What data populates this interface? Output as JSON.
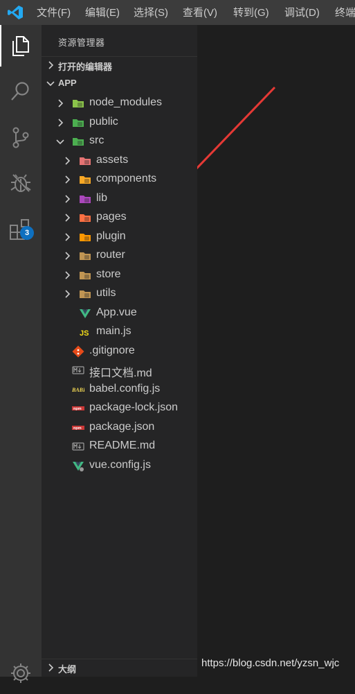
{
  "menu": [
    {
      "id": "file",
      "label": "文件(F)"
    },
    {
      "id": "edit",
      "label": "编辑(E)"
    },
    {
      "id": "selection",
      "label": "选择(S)"
    },
    {
      "id": "view",
      "label": "查看(V)"
    },
    {
      "id": "goto",
      "label": "转到(G)"
    },
    {
      "id": "debug",
      "label": "调试(D)"
    },
    {
      "id": "terminal",
      "label": "终端"
    }
  ],
  "activity": {
    "extensions_badge": "3"
  },
  "sidebar": {
    "title": "资源管理器",
    "open_editors": "打开的编辑器",
    "app": "APP",
    "outline": "大纲"
  },
  "tree": [
    {
      "label": "node_modules",
      "kind": "folder",
      "depth": 0,
      "expanded": false,
      "icon": "node-folder-icon",
      "color": "#8bc34a"
    },
    {
      "label": "public",
      "kind": "folder",
      "depth": 0,
      "expanded": false,
      "icon": "public-folder-icon",
      "color": "#4caf50"
    },
    {
      "label": "src",
      "kind": "folder",
      "depth": 0,
      "expanded": true,
      "icon": "src-folder-icon",
      "color": "#4caf50"
    },
    {
      "label": "assets",
      "kind": "folder",
      "depth": 1,
      "expanded": false,
      "icon": "assets-folder-icon",
      "color": "#e57373"
    },
    {
      "label": "components",
      "kind": "folder",
      "depth": 1,
      "expanded": false,
      "icon": "components-folder-icon",
      "color": "#f9a825"
    },
    {
      "label": "lib",
      "kind": "folder",
      "depth": 1,
      "expanded": false,
      "icon": "lib-folder-icon",
      "color": "#ab47bc"
    },
    {
      "label": "pages",
      "kind": "folder",
      "depth": 1,
      "expanded": false,
      "icon": "pages-folder-icon",
      "color": "#ff7043"
    },
    {
      "label": "plugin",
      "kind": "folder",
      "depth": 1,
      "expanded": false,
      "icon": "plugin-folder-icon",
      "color": "#ff9800"
    },
    {
      "label": "router",
      "kind": "folder",
      "depth": 1,
      "expanded": false,
      "icon": "router-folder-icon",
      "color": "#c09553"
    },
    {
      "label": "store",
      "kind": "folder",
      "depth": 1,
      "expanded": false,
      "icon": "store-folder-icon",
      "color": "#c09553"
    },
    {
      "label": "utils",
      "kind": "folder",
      "depth": 1,
      "expanded": false,
      "icon": "utils-folder-icon",
      "color": "#c09553"
    },
    {
      "label": "App.vue",
      "kind": "file",
      "depth": 1,
      "icon": "vue-file-icon",
      "color": "#41b883"
    },
    {
      "label": "main.js",
      "kind": "file",
      "depth": 1,
      "icon": "js-file-icon",
      "color": "#f5de19"
    },
    {
      "label": ".gitignore",
      "kind": "file",
      "depth": 0,
      "icon": "git-file-icon",
      "color": "#e64a19"
    },
    {
      "label": "接口文档.md",
      "kind": "file",
      "depth": 0,
      "icon": "markdown-file-icon",
      "color": "#9e9e9e"
    },
    {
      "label": "babel.config.js",
      "kind": "file",
      "depth": 0,
      "icon": "babel-file-icon",
      "color": "#f5da55"
    },
    {
      "label": "package-lock.json",
      "kind": "file",
      "depth": 0,
      "icon": "npm-file-icon",
      "color": "#cb3837"
    },
    {
      "label": "package.json",
      "kind": "file",
      "depth": 0,
      "icon": "npm-file-icon",
      "color": "#cb3837"
    },
    {
      "label": "README.md",
      "kind": "file",
      "depth": 0,
      "icon": "markdown-file-icon",
      "color": "#9e9e9e"
    },
    {
      "label": "vue.config.js",
      "kind": "file",
      "depth": 0,
      "icon": "vue-config-file-icon",
      "color": "#41b883"
    }
  ],
  "watermark": "https://blog.csdn.net/yzsn_wjc",
  "colors": {
    "accent_arrow": "#e53935",
    "badge": "#0e70c0",
    "vscode_blue": "#23a9f2"
  }
}
